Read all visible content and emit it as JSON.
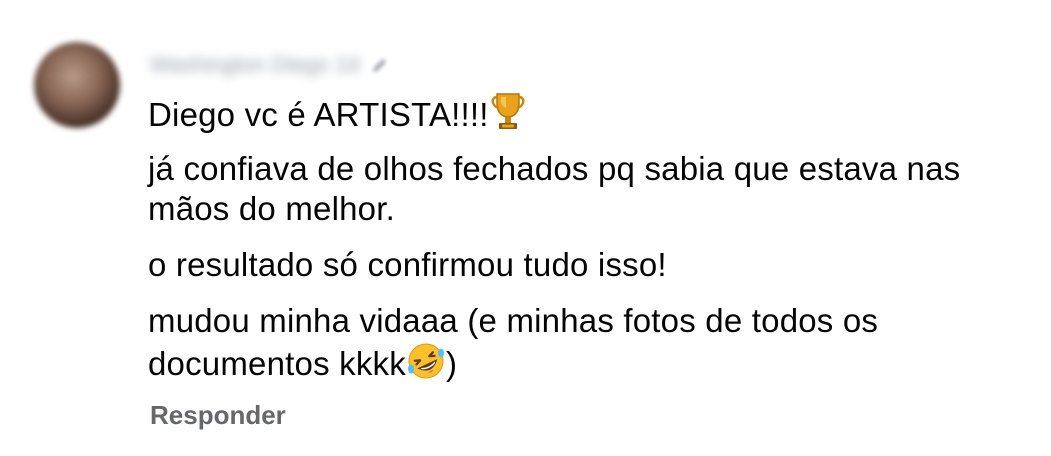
{
  "comment": {
    "author_text": "Washington Diego 1d",
    "lines": {
      "l1_text": "Diego vc é ARTISTA!!!!",
      "l1_emoji": "trophy-emoji",
      "p2": "já confiava de olhos fechados pq sabia que estava nas mãos do melhor.",
      "p3": "o resultado só confirmou tudo isso!",
      "p4_text": "mudou minha vidaaa (e minhas fotos de todos os documentos kkkk",
      "p4_emoji": "rofl-emoji",
      "p4_close": ")"
    },
    "reply_label": "Responder",
    "colors": {
      "text": "#050505",
      "secondary": "#65676b",
      "background": "#ffffff"
    }
  }
}
